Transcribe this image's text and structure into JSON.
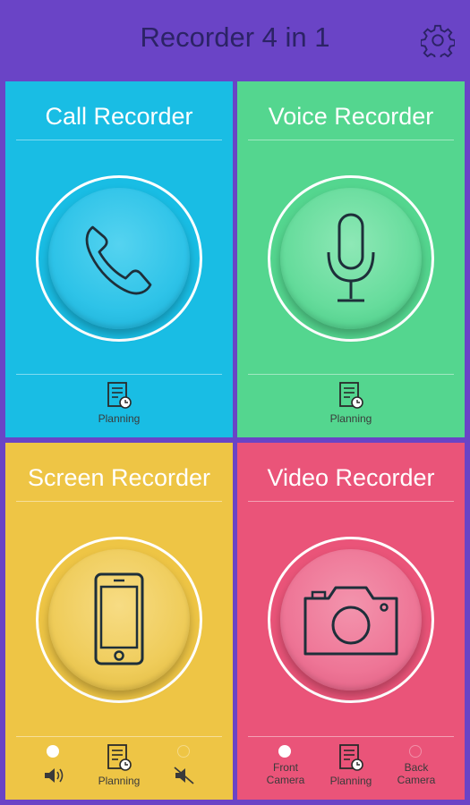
{
  "header": {
    "title": "Recorder 4 in 1",
    "settings_icon": "gear-icon"
  },
  "cards": {
    "call": {
      "title": "Call Recorder",
      "icon": "phone-handset-icon",
      "color": "#19bde4",
      "planning_label": "Planning"
    },
    "voice": {
      "title": "Voice Recorder",
      "icon": "microphone-icon",
      "color": "#54d68f",
      "planning_label": "Planning"
    },
    "screen": {
      "title": "Screen Recorder",
      "icon": "smartphone-icon",
      "color": "#eec545",
      "planning_label": "Planning",
      "options": [
        "sound-on-icon",
        "sound-off-icon"
      ],
      "selected_option": "sound-on-icon"
    },
    "video": {
      "title": "Video Recorder",
      "icon": "camera-icon",
      "color": "#ea5479",
      "planning_label": "Planning",
      "front_camera_line1": "Front",
      "front_camera_line2": "Camera",
      "back_camera_line1": "Back",
      "back_camera_line2": "Camera",
      "selected_option": "front"
    }
  }
}
